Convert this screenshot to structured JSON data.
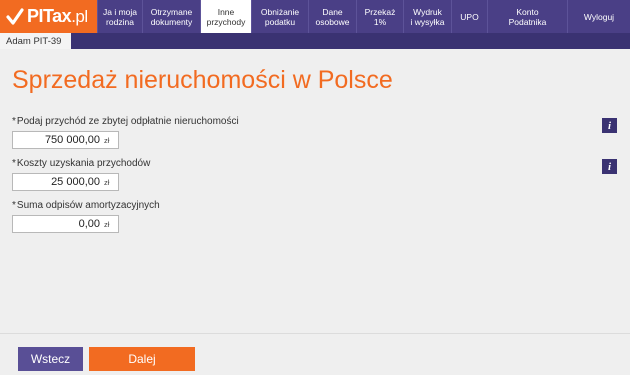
{
  "logo": {
    "main": "PITax",
    "suffix": ".pl"
  },
  "nav": [
    {
      "label": "Ja i moja rodzina",
      "lines": [
        "Ja i moja",
        "rodzina"
      ],
      "active": false
    },
    {
      "label": "Otrzymane dokumenty",
      "lines": [
        "Otrzymane",
        "dokumenty"
      ],
      "active": false
    },
    {
      "label": "Inne przychody",
      "lines": [
        "Inne",
        "przychody"
      ],
      "active": true
    },
    {
      "label": "Obniżanie podatku",
      "lines": [
        "Obniżanie",
        "podatku"
      ],
      "active": false
    },
    {
      "label": "Dane osobowe",
      "lines": [
        "Dane",
        "osobowe"
      ],
      "active": false
    },
    {
      "label": "Przekaż 1%",
      "lines": [
        "Przekaż",
        "1%"
      ],
      "active": false
    },
    {
      "label": "Wydruk i wysyłka",
      "lines": [
        "Wydruk",
        "i wysyłka"
      ],
      "active": false
    },
    {
      "label": "UPO",
      "lines": [
        "UPO"
      ],
      "active": false
    },
    {
      "label": "Konto Podatnika",
      "lines": [
        "Konto",
        "Podatnika"
      ],
      "active": false
    },
    {
      "label": "Wyloguj",
      "lines": [
        "Wyloguj"
      ],
      "active": false
    }
  ],
  "subtab": {
    "label": "Adam PIT-39"
  },
  "page_title": "Sprzedaż nieruchomości w Polsce",
  "fields": [
    {
      "required_mark": "*",
      "label": "Podaj przychód ze zbytej odpłatnie nieruchomości",
      "value": "750 000,00",
      "unit": "zł",
      "has_info": true
    },
    {
      "required_mark": "*",
      "label": "Koszty uzyskania przychodów",
      "value": "25 000,00",
      "unit": "zł",
      "has_info": true
    },
    {
      "required_mark": "*",
      "label": "Suma odpisów amortyzacyjnych",
      "value": "0,00",
      "unit": "zł",
      "has_info": false
    }
  ],
  "info_glyph": "i",
  "buttons": {
    "back": "Wstecz",
    "next": "Dalej"
  },
  "colors": {
    "brand_orange": "#f26b21",
    "nav_purple": "#4a3f86",
    "dark_purple": "#3a3272",
    "back_button": "#594f96"
  }
}
